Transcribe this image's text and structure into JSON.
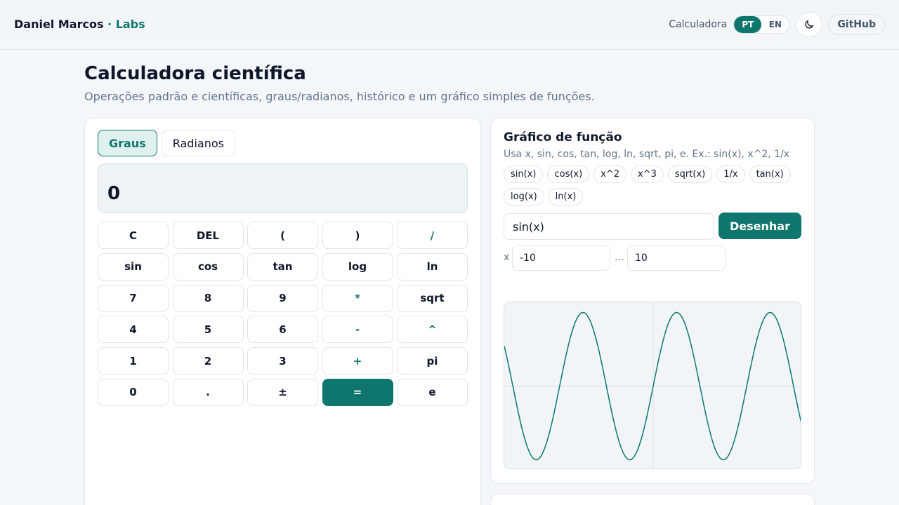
{
  "header": {
    "brand_name": "Daniel Marcos",
    "brand_sep": " · ",
    "brand_suffix": "Labs",
    "section_label": "Calculadora",
    "languages": [
      {
        "label": "PT",
        "active": true
      },
      {
        "label": "EN",
        "active": false
      }
    ],
    "theme_icon": "moon-icon",
    "github_label": "GitHub"
  },
  "page": {
    "title": "Calculadora científica",
    "subtitle": "Operações padrão e científicas, graus/radianos, histórico e um gráfico simples de funções."
  },
  "calculator": {
    "modes": [
      {
        "label": "Graus",
        "active": true
      },
      {
        "label": "Radianos",
        "active": false
      }
    ],
    "display_value": "0",
    "keys": [
      {
        "label": "C",
        "kind": "fn"
      },
      {
        "label": "DEL",
        "kind": "fn"
      },
      {
        "label": "(",
        "kind": "fn"
      },
      {
        "label": ")",
        "kind": "fn"
      },
      {
        "label": "/",
        "kind": "op"
      },
      {
        "label": "sin",
        "kind": "fn"
      },
      {
        "label": "cos",
        "kind": "fn"
      },
      {
        "label": "tan",
        "kind": "fn"
      },
      {
        "label": "log",
        "kind": "fn"
      },
      {
        "label": "ln",
        "kind": "fn"
      },
      {
        "label": "7",
        "kind": "num"
      },
      {
        "label": "8",
        "kind": "num"
      },
      {
        "label": "9",
        "kind": "num"
      },
      {
        "label": "*",
        "kind": "op"
      },
      {
        "label": "sqrt",
        "kind": "fn"
      },
      {
        "label": "4",
        "kind": "num"
      },
      {
        "label": "5",
        "kind": "num"
      },
      {
        "label": "6",
        "kind": "num"
      },
      {
        "label": "-",
        "kind": "op"
      },
      {
        "label": "^",
        "kind": "op"
      },
      {
        "label": "1",
        "kind": "num"
      },
      {
        "label": "2",
        "kind": "num"
      },
      {
        "label": "3",
        "kind": "num"
      },
      {
        "label": "+",
        "kind": "op"
      },
      {
        "label": "pi",
        "kind": "fn"
      },
      {
        "label": "0",
        "kind": "num"
      },
      {
        "label": ".",
        "kind": "num"
      },
      {
        "label": "±",
        "kind": "fn"
      },
      {
        "label": "=",
        "kind": "eq"
      },
      {
        "label": "e",
        "kind": "fn"
      }
    ]
  },
  "graph": {
    "title": "Gráfico de função",
    "hint": "Usa x, sin, cos, tan, log, ln, sqrt, pi, e. Ex.: sin(x), x^2, 1/x",
    "presets": [
      "sin(x)",
      "cos(x)",
      "x^2",
      "x^3",
      "sqrt(x)",
      "1/x",
      "tan(x)",
      "log(x)",
      "ln(x)"
    ],
    "expression": "sin(x)",
    "draw_label": "Desenhar",
    "x_label": "x",
    "range_sep": "…",
    "x_min": "-10",
    "x_max": "10",
    "line_color": "#0f766e",
    "axis_color": "#d8e0e6"
  }
}
